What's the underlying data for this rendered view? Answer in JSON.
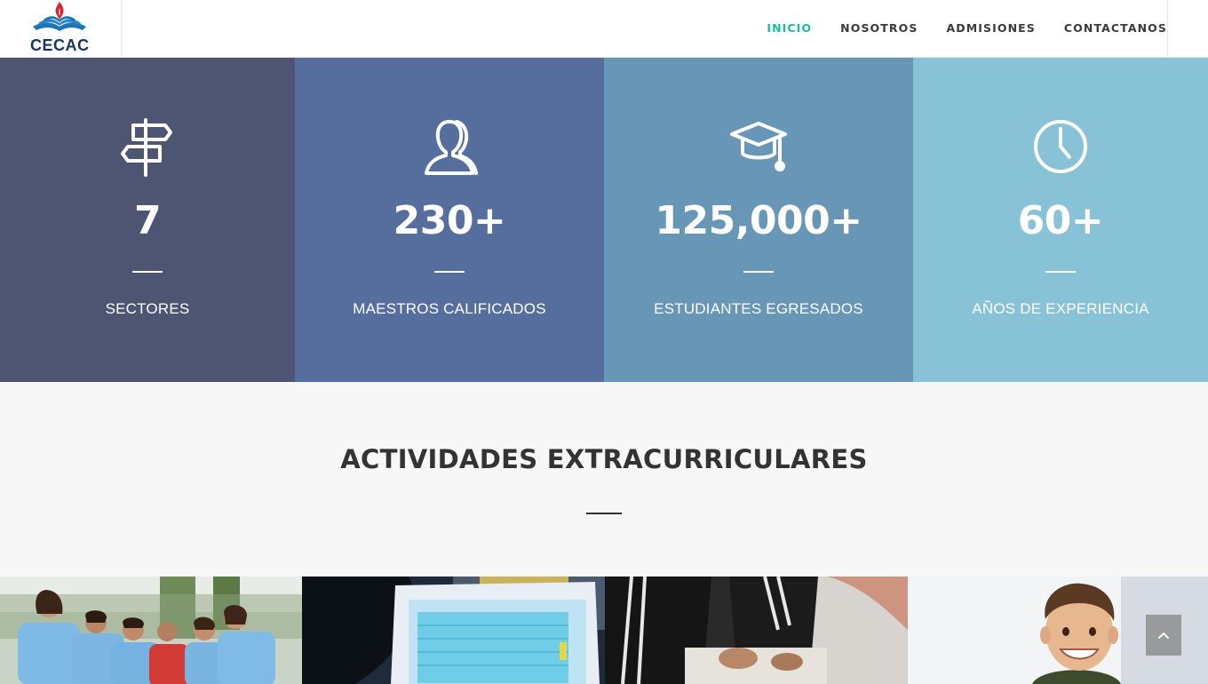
{
  "header": {
    "logo_text": "CECAC",
    "nav": [
      {
        "label": "INICIO",
        "active": true
      },
      {
        "label": "NOSOTROS",
        "active": false
      },
      {
        "label": "ADMISIONES",
        "active": false
      },
      {
        "label": "CONTACTANOS",
        "active": false
      }
    ]
  },
  "stats": [
    {
      "icon": "signpost-icon",
      "number": "7",
      "label": "SECTORES",
      "color": "#4d5573"
    },
    {
      "icon": "user-icon",
      "number": "230+",
      "label": "MAESTROS CALIFICADOS",
      "color": "#566e9e"
    },
    {
      "icon": "graduation-cap-icon",
      "number": "125,000+",
      "label": "ESTUDIANTES EGRESADOS",
      "color": "#6796b6"
    },
    {
      "icon": "clock-icon",
      "number": "60+",
      "label": "AÑOS DE EXPERIENCIA",
      "color": "#88c2d6"
    }
  ],
  "activities": {
    "title": "ACTIVIDADES EXTRACURRICULARES",
    "photos": [
      "soccer-team-photo",
      "laptop-photo",
      "students-desk-photo",
      "smiling-boy-photo"
    ]
  },
  "colors": {
    "accent": "#1abc9c",
    "nav_text": "#3a3a3a",
    "section_bg": "#f7f7f7"
  }
}
